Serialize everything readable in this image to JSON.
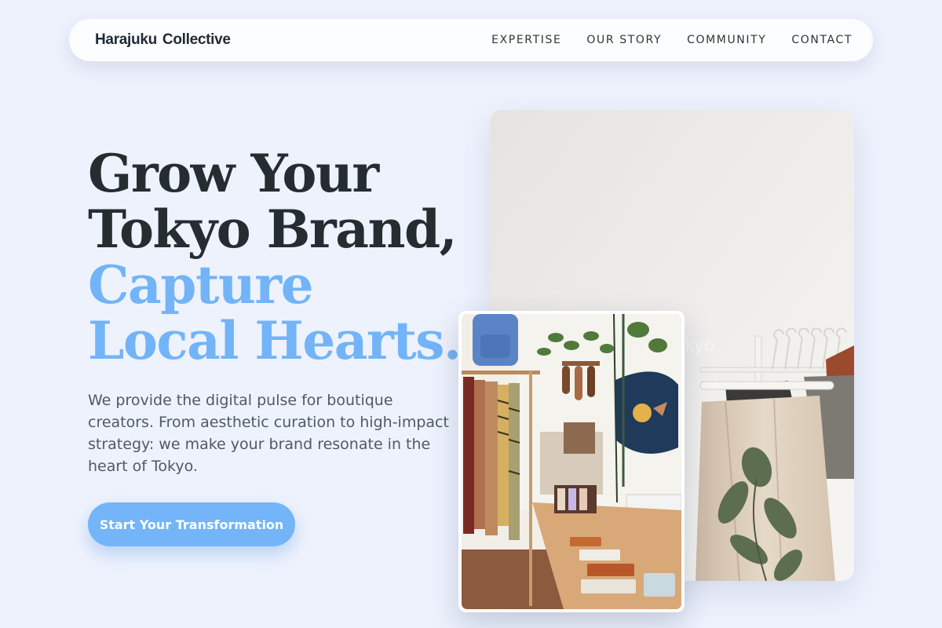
{
  "nav": {
    "brand_word1": "Harajuku",
    "brand_word2": "Collective",
    "links": [
      "EXPERTISE",
      "OUR STORY",
      "COMMUNITY",
      "CONTACT"
    ]
  },
  "hero": {
    "headline_line1": "Grow Your",
    "headline_line2": "Tokyo Brand,",
    "headline_line3": "Capture",
    "headline_line4": "Local Hearts.",
    "description": "We provide the digital pulse for boutique creators. From aesthetic curation to high-impact strategy: we make your brand resonate in the heart of Tokyo.",
    "cta_label": "Start Your Transformation"
  },
  "images": {
    "large_watermark": "kyo"
  },
  "colors": {
    "background": "#eef2fd",
    "accent": "#72b4f7",
    "heading": "#262d31",
    "body_text": "#4d5a66"
  }
}
